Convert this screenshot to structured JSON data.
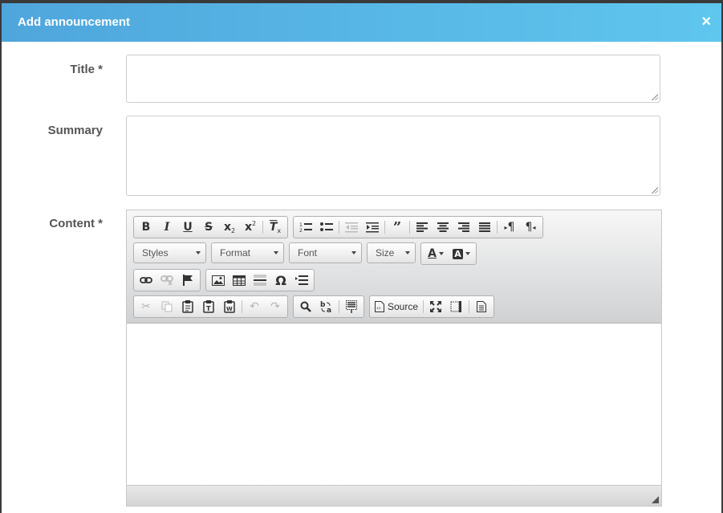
{
  "dialog": {
    "title": "Add announcement",
    "close_glyph": "×"
  },
  "form": {
    "title_label": "Title *",
    "title_value": "",
    "summary_label": "Summary",
    "summary_value": "",
    "content_label": "Content *",
    "content_value": ""
  },
  "toolbar": {
    "combos": {
      "styles": "Styles",
      "format": "Format",
      "font": "Font",
      "size": "Size"
    },
    "source_label": "Source"
  },
  "colors": {
    "header_start": "#4fa6dc",
    "header_end": "#5fc6ee"
  }
}
